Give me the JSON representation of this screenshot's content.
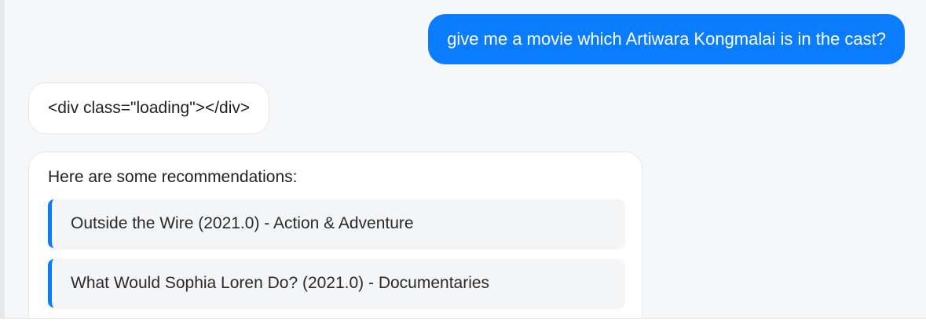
{
  "conversation": {
    "user_message": "give me a movie which Artiwara Kongmalai is in the cast?",
    "bot_loading_message": "<div class=\"loading\"></div>",
    "bot_recommendations": {
      "intro": "Here are some recommendations:",
      "items": [
        {
          "label": "Outside the Wire (2021.0) - Action & Adventure"
        },
        {
          "label": "What Would Sophia Loren Do? (2021.0) - Documentaries"
        }
      ]
    }
  },
  "colors": {
    "accent": "#0a7cff",
    "background": "#f6f7f9",
    "bubble": "#ffffff",
    "item_background": "#f4f5f7"
  }
}
